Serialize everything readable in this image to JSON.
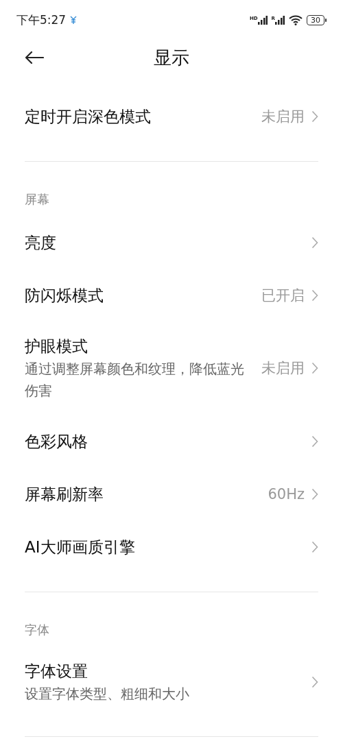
{
  "status_bar": {
    "time": "下午5:27",
    "signals": [
      {
        "label": "HD"
      },
      {
        "label": "R"
      }
    ],
    "battery": "30"
  },
  "title": "显示",
  "sections": [
    {
      "items": [
        {
          "title": "定时开启深色模式",
          "value": "未启用"
        }
      ]
    },
    {
      "header": "屏幕",
      "items": [
        {
          "title": "亮度"
        },
        {
          "title": "防闪烁模式",
          "value": "已开启"
        },
        {
          "title": "护眼模式",
          "subtitle": "通过调整屏幕颜色和纹理，降低蓝光伤害",
          "value": "未启用"
        },
        {
          "title": "色彩风格"
        },
        {
          "title": "屏幕刷新率",
          "value": "60Hz"
        },
        {
          "title": "AI大师画质引擎"
        }
      ]
    },
    {
      "header": "字体",
      "items": [
        {
          "title": "字体设置",
          "subtitle": "设置字体类型、粗细和大小"
        }
      ]
    }
  ]
}
